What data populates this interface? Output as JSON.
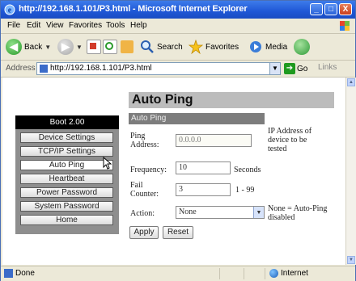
{
  "window": {
    "title": "http://192.168.1.101/P3.html - Microsoft Internet Explorer",
    "controls": {
      "minimize": "_",
      "maximize": "□",
      "close": "X"
    }
  },
  "menu": [
    "File",
    "Edit",
    "View",
    "Favorites",
    "Tools",
    "Help"
  ],
  "toolbar": {
    "back_label": "Back",
    "search_label": "Search",
    "favorites_label": "Favorites",
    "media_label": "Media"
  },
  "address": {
    "label": "Address",
    "url": "http://192.168.1.101/P3.html",
    "go_label": "Go",
    "links_label": "Links"
  },
  "nav": {
    "header": "Boot 2.00",
    "items": [
      {
        "label": "Device Settings"
      },
      {
        "label": "TCP/IP Settings"
      },
      {
        "label": "Auto Ping"
      },
      {
        "label": "Heartbeat"
      },
      {
        "label": "Power Password"
      },
      {
        "label": "System Password"
      },
      {
        "label": "Home"
      }
    ],
    "active_index": 2
  },
  "main": {
    "title": "Auto Ping",
    "section": "Auto Ping",
    "ping_address": {
      "label": "Ping Address:",
      "value": "0.0.0.0",
      "note": "IP Address of device to be tested"
    },
    "frequency": {
      "label": "Frequency:",
      "value": "10",
      "unit": "Seconds"
    },
    "fail_counter": {
      "label": "Fail Counter:",
      "value": "3",
      "range": "1 - 99"
    },
    "action": {
      "label": "Action:",
      "selected": "None",
      "note": "None = Auto-Ping disabled"
    },
    "apply_label": "Apply",
    "reset_label": "Reset"
  },
  "status": {
    "text": "Done",
    "zone": "Internet"
  },
  "colors": {
    "titlebar": "#1f57d6",
    "nav_header": "#000000",
    "nav_panel": "#8e8e8e",
    "page_title_bg": "#bcbcbc",
    "section_bg": "#7d7d7d"
  }
}
